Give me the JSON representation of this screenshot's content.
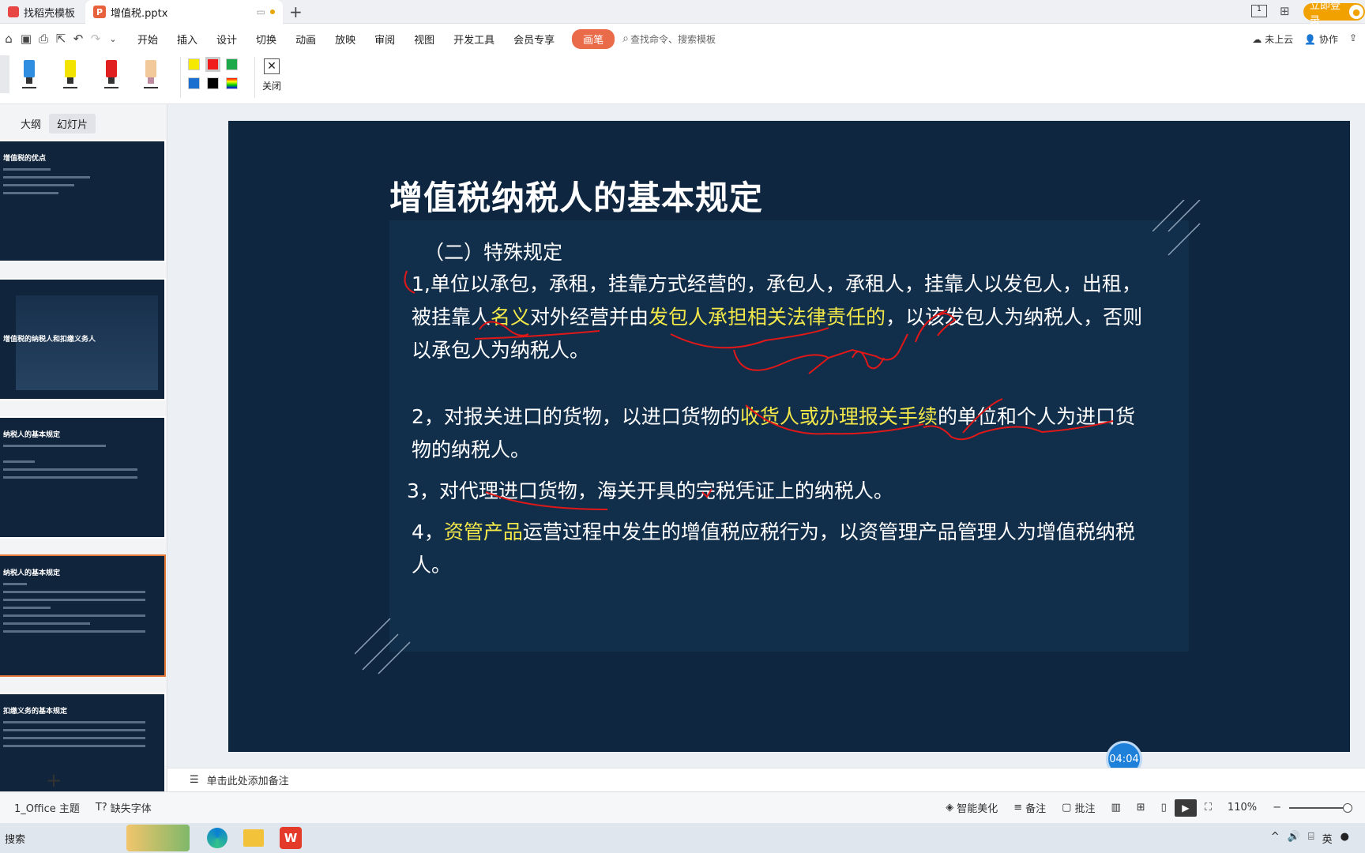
{
  "tabs": [
    {
      "label": "找稻壳模板"
    },
    {
      "label": "增值税.pptx"
    }
  ],
  "login_label": "立即登录",
  "menu": [
    "开始",
    "插入",
    "设计",
    "切换",
    "动画",
    "放映",
    "审阅",
    "视图",
    "开发工具",
    "会员专享"
  ],
  "pen_tab": "画笔",
  "search_placeholder": "查找命令、搜索模板",
  "cloud_label": "未上云",
  "collab_label": "协作",
  "ribbon": {
    "close_label": "关闭",
    "marker_colors": [
      "#2f8ee0",
      "#f2e400",
      "#e02020",
      "#f1c99a"
    ],
    "swatches": [
      "#f5e900",
      "#f01c1c",
      "#1da84a",
      "#1a6fcf",
      "#000000"
    ]
  },
  "left_panel": {
    "tab_outline": "大纲",
    "tab_slides": "幻灯片"
  },
  "thumbs": [
    {
      "title": "增值税的优点"
    },
    {
      "title": "增值税的纳税人和扣缴义务人"
    },
    {
      "title": "纳税人的基本规定"
    },
    {
      "title": "纳税人的基本规定"
    },
    {
      "title": "扣缴义务的基本规定"
    }
  ],
  "slide": {
    "title": "增值税纳税人的基本规定",
    "subtitle": "（二）特殊规定",
    "p1_a": "1,单位以承包，承租，挂靠方式经营的，承包人，承租人，挂靠人以发包人，出租，",
    "p1_b1": "被挂靠人",
    "p1_b2": "名义",
    "p1_b3": "对外经营并由",
    "p1_b4": "发包人承担相关法律责任的",
    "p1_b5": "，以该发包人为纳税人，否则",
    "p1_c": "以承包人为纳税人。",
    "p2_a1": "2，对报关进口的货物，以进口货物的",
    "p2_a2": "收货人或办理报关手续",
    "p2_a3": "的单位和个人为进口货",
    "p2_b": "物的纳税人。",
    "p3": " 3，对代理进口货物，海关开具的完税凭证上的纳税人。",
    "p4_a1": "4，",
    "p4_a2": "资管产品",
    "p4_a3": "运营过程中发生的增值税应税行为，以资管理产品管理人为增值税纳税",
    "p4_b": "人。"
  },
  "timer": "04:04",
  "notes_placeholder": "单击此处添加备注",
  "status": {
    "theme": "1_Office 主题",
    "missing_font": "缺失字体",
    "beautify": "智能美化",
    "notes": "备注",
    "comment": "批注",
    "zoom": "110%"
  },
  "taskbar": {
    "search": "搜索",
    "ime": "英"
  }
}
